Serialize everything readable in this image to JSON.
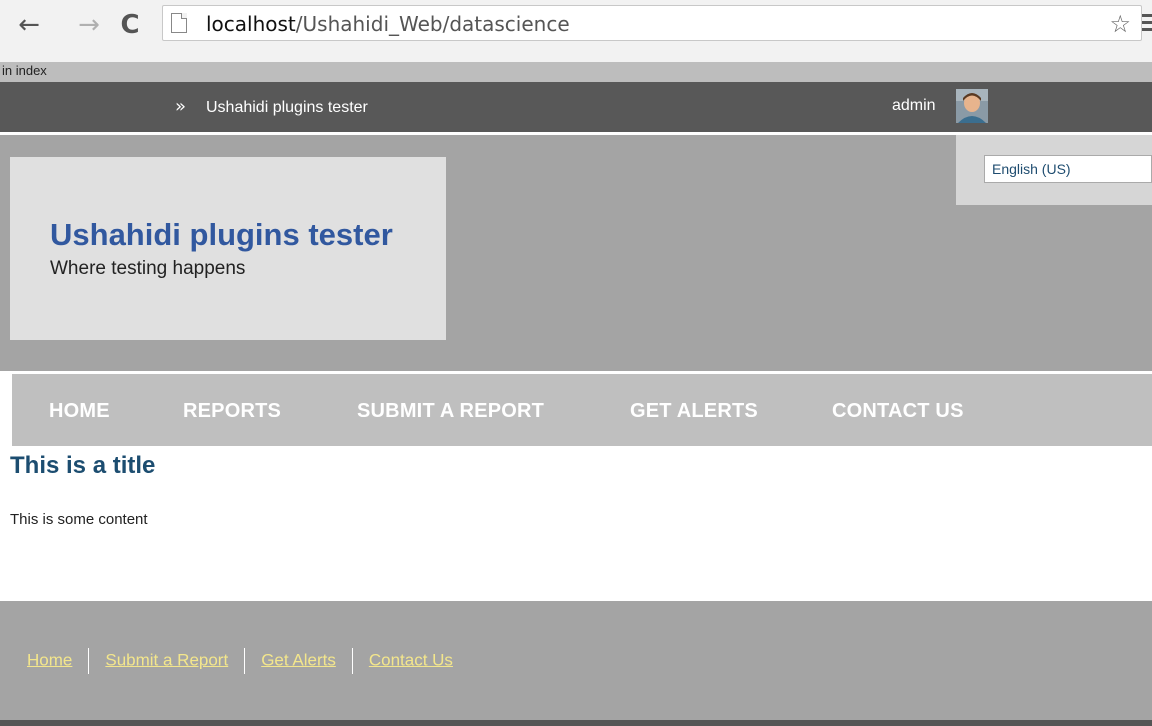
{
  "browser": {
    "back_icon": "←",
    "forward_icon": "→",
    "reload_icon": "C",
    "url_host": "localhost",
    "url_path": "/Ushahidi_Web/datascience",
    "star_icon": "☆"
  },
  "debug_text": "in index",
  "header": {
    "chevron": "»",
    "site_name": "Ushahidi plugins tester",
    "username": "admin"
  },
  "banner": {
    "title": "Ushahidi plugins tester",
    "tagline": "Where testing happens",
    "language": "English (US)"
  },
  "nav": {
    "items": [
      {
        "label": "HOME"
      },
      {
        "label": "REPORTS"
      },
      {
        "label": "SUBMIT A REPORT"
      },
      {
        "label": "GET ALERTS"
      },
      {
        "label": "CONTACT US"
      }
    ]
  },
  "content": {
    "title": "This is a title",
    "body": "This is some content"
  },
  "footer": {
    "links": [
      {
        "label": "Home"
      },
      {
        "label": "Submit a Report"
      },
      {
        "label": "Get Alerts"
      },
      {
        "label": "Contact Us"
      }
    ]
  },
  "colors": {
    "topbar": "#585858",
    "banner": "#a4a4a4",
    "site_title": "#31589f",
    "content_title": "#1c4d70",
    "footer_link": "#f3e68c"
  }
}
